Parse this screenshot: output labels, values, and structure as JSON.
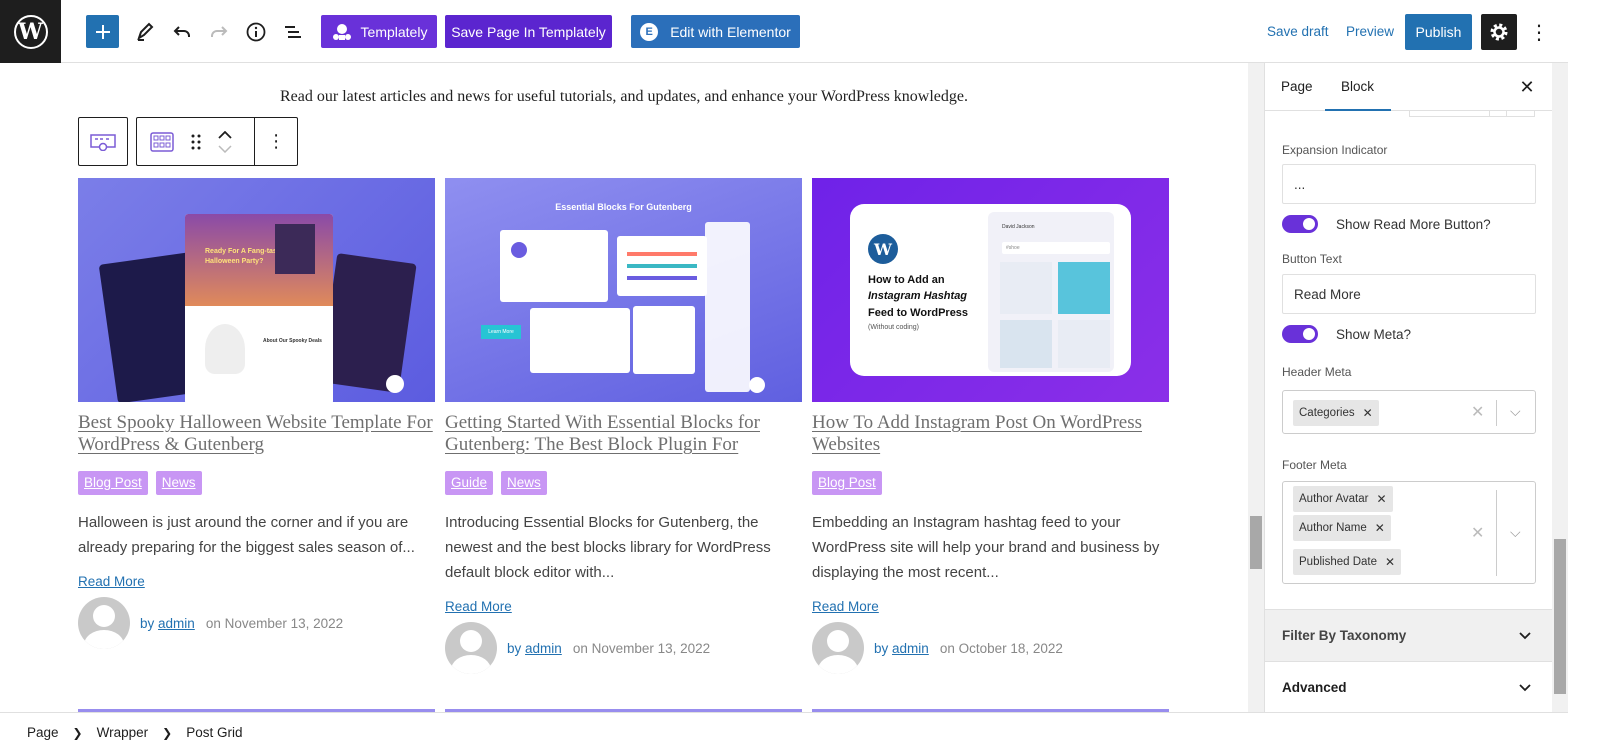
{
  "toolbar": {
    "templately_label": "Templately",
    "save_templately_label": "Save Page In Templately",
    "elementor_label": "Edit with Elementor",
    "save_draft_label": "Save draft",
    "preview_label": "Preview",
    "publish_label": "Publish"
  },
  "canvas": {
    "intro_text": "Read our latest articles and news for useful tutorials, and updates, and enhance your WordPress knowledge."
  },
  "posts": [
    {
      "title": "Best Spooky Halloween Website Template For WordPress & Gutenberg",
      "tags": [
        "Blog Post",
        "News"
      ],
      "excerpt": "Halloween is just around the corner and if you are already preparing for the biggest sales season of...",
      "read_more": "Read More",
      "by": "by",
      "author": "admin",
      "date": "on November 13, 2022",
      "thumb_text": [
        "Ready For A Fang-tastic",
        "Halloween Party?",
        "About Our Spooky Deals"
      ]
    },
    {
      "title": "Getting Started With Essential Blocks for Gutenberg: The Best Block Plugin For",
      "tags": [
        "Guide",
        "News"
      ],
      "excerpt": "Introducing Essential Blocks for Gutenberg, the newest and the best blocks library for WordPress default block editor with...",
      "read_more": "Read More",
      "by": "by",
      "author": "admin",
      "date": "on November 13, 2022",
      "thumb_text": [
        "Essential Blocks For Gutenberg",
        "Learn More"
      ]
    },
    {
      "title": "How To Add Instagram Post On WordPress Websites",
      "tags": [
        "Blog Post"
      ],
      "excerpt": "Embedding an Instagram hashtag feed to your WordPress site will help your brand and business by displaying the most recent...",
      "read_more": "Read More",
      "by": "by",
      "author": "admin",
      "date": "on October 18, 2022",
      "thumb_text": [
        "How to Add an",
        "Instagram Hashtag",
        "Feed to WordPress",
        "(Without coding)",
        "David Jackson",
        "#shoe"
      ]
    }
  ],
  "sidebar": {
    "tab_page": "Page",
    "tab_block": "Block",
    "expansion_label": "Expansion Indicator",
    "expansion_value": "...",
    "show_read_more_label": "Show Read More Button?",
    "button_text_label": "Button Text",
    "button_text_value": "Read More",
    "show_meta_label": "Show Meta?",
    "header_meta_label": "Header Meta",
    "header_meta_chips": [
      "Categories"
    ],
    "footer_meta_label": "Footer Meta",
    "footer_meta_chips": [
      "Author Avatar",
      "Author Name",
      "Published Date"
    ],
    "filter_taxonomy_label": "Filter By Taxonomy",
    "advanced_label": "Advanced"
  },
  "breadcrumb": [
    "Page",
    "Wrapper",
    "Post Grid"
  ],
  "colors": {
    "wp_blue": "#2271b1",
    "templately_purple": "#6931d9",
    "elementor_blue": "#2b6fba",
    "tag_purple": "#c896f4"
  }
}
